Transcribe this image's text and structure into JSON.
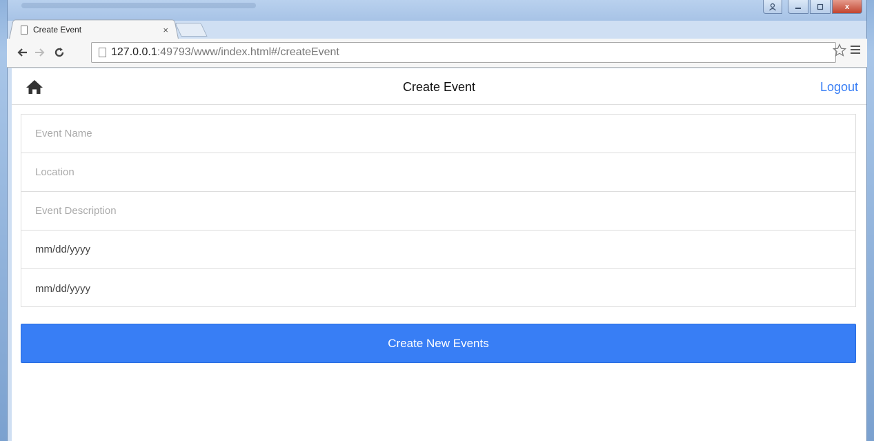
{
  "browser": {
    "tab_title": "Create Event",
    "tab_close": "×",
    "url_host": "127.0.0.1",
    "url_rest": ":49793/www/index.html#/createEvent",
    "window_close_label": "x"
  },
  "app": {
    "header_title": "Create Event",
    "logout_label": "Logout",
    "accent_color": "#387ef5"
  },
  "form": {
    "event_name_placeholder": "Event Name",
    "location_placeholder": "Location",
    "description_placeholder": "Event Description",
    "start_date_value": "mm/dd/yyyy",
    "end_date_value": "mm/dd/yyyy",
    "submit_label": "Create New Events"
  },
  "icons": {
    "home": "home-icon",
    "back": "back-arrow-icon",
    "forward": "forward-arrow-icon",
    "reload": "reload-icon",
    "bookmark": "star-icon",
    "menu": "menu-icon"
  }
}
